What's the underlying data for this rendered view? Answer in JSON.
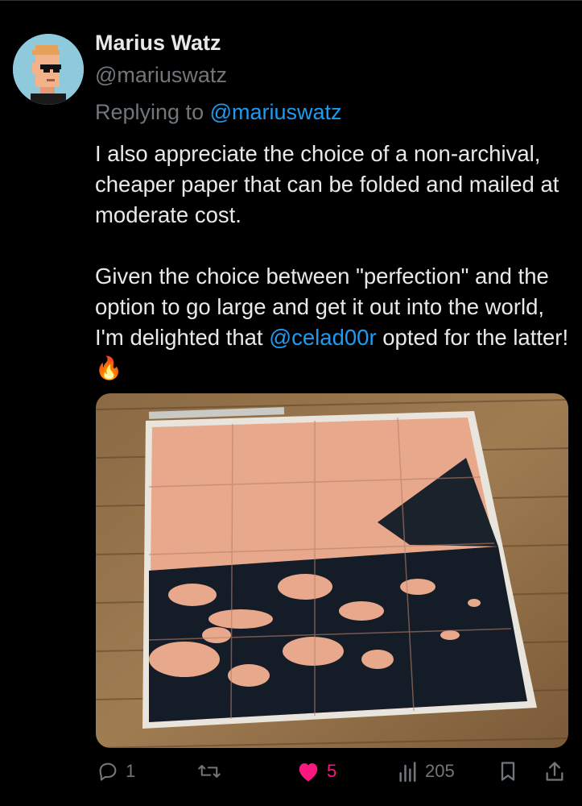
{
  "tweet": {
    "author_name": "Marius Watz",
    "author_handle": "@mariuswatz",
    "replying_prefix": "Replying to",
    "replying_to": "@mariuswatz",
    "paragraph1": "I also appreciate the choice of a non-archival, cheaper paper that can be folded and mailed at moderate cost.",
    "paragraph2_before": "Given the choice between \"perfection\" and the option to go large and get it out into the world, I'm delighted that ",
    "paragraph2_mention": "@celad00r",
    "paragraph2_after": " opted for the latter! ",
    "emoji": "🔥"
  },
  "actions": {
    "replies": "1",
    "reposts": "",
    "likes": "5",
    "views": "205"
  },
  "colors": {
    "background": "#000000",
    "text": "#e7e9ea",
    "muted": "#71767b",
    "link": "#1d9bf0",
    "like": "#f91880"
  },
  "icons": [
    "reply-icon",
    "repost-icon",
    "heart-icon",
    "views-icon",
    "bookmark-icon",
    "share-icon"
  ]
}
